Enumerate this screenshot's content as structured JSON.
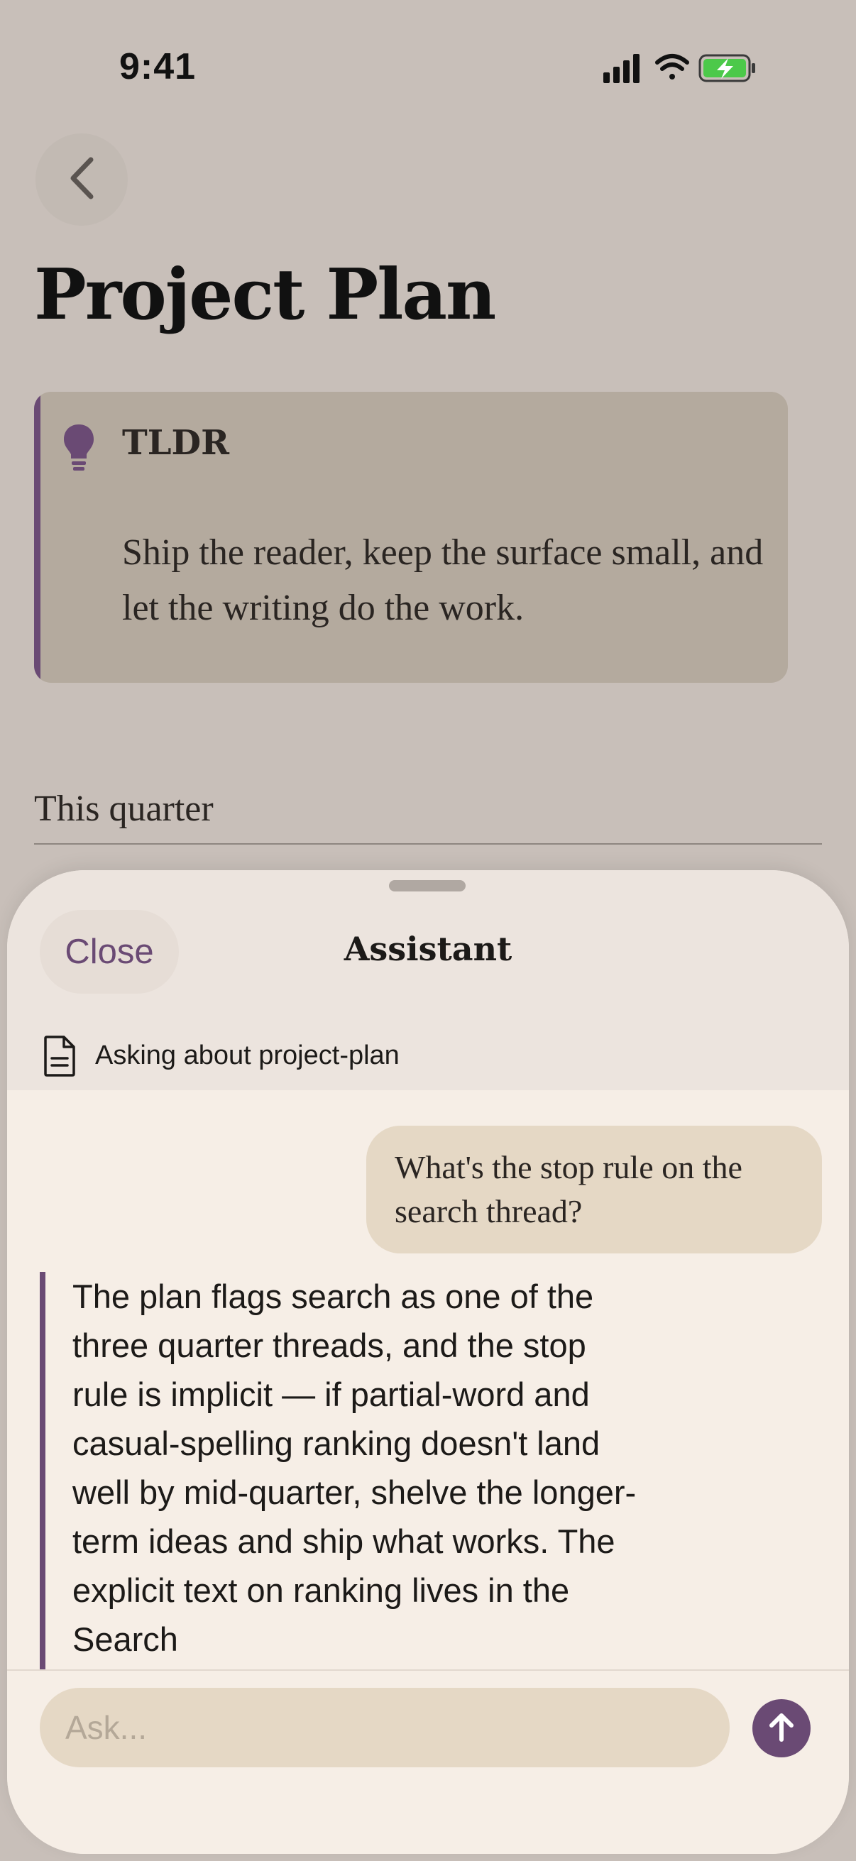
{
  "status_bar": {
    "time": "9:41",
    "icons": [
      "signal-icon",
      "wifi-icon",
      "battery-charging-icon"
    ],
    "battery_color": "#4cc94a"
  },
  "page": {
    "back_icon": "chevron-left-icon",
    "title": "Project Plan",
    "tldr": {
      "icon": "lightbulb-icon",
      "heading": "TLDR",
      "body": "Ship the reader, keep the surface small, and let the writing do the work."
    },
    "section_label": "This quarter"
  },
  "assistant_sheet": {
    "close_label": "Close",
    "title": "Assistant",
    "context": {
      "icon": "document-icon",
      "label": "Asking about project-plan"
    },
    "messages": [
      {
        "role": "user",
        "text": "What's the stop rule on the search thread?"
      },
      {
        "role": "assistant",
        "text": "The plan flags search as one of the three quarter threads, and the stop rule is implicit — if partial-word and casual-spelling ranking doesn't land well by mid-quarter, shelve the longer-term ideas and ship what works. The explicit text on ranking lives in the Search"
      }
    ],
    "composer": {
      "placeholder": "Ask...",
      "send_icon": "arrow-up-icon"
    }
  },
  "colors": {
    "accent": "#6a4a74",
    "page_background": "#c8bfb9",
    "sheet_background": "#f6eee6",
    "bubble": "#e5d8c5"
  }
}
